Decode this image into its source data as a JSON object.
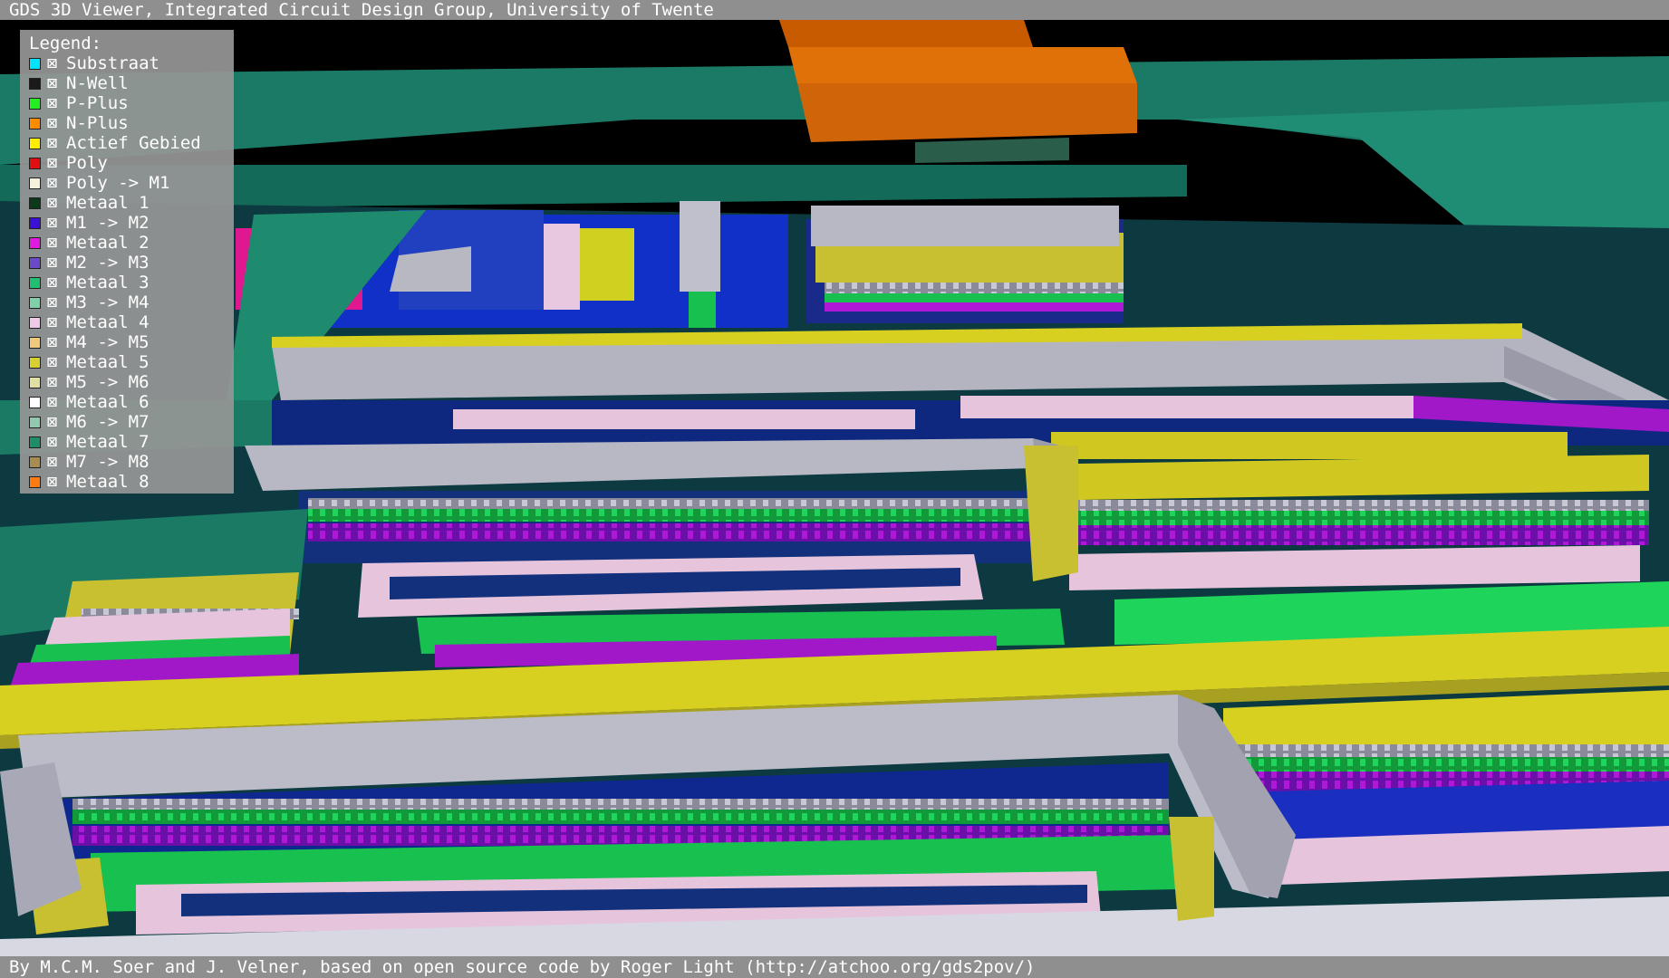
{
  "window": {
    "title": "GDS 3D Viewer, Integrated Circuit Design Group, University of Twente"
  },
  "legend": {
    "title": "Legend:",
    "items": [
      {
        "label": "Substraat",
        "color": "#00e5ff",
        "checked": "⊠"
      },
      {
        "label": "N-Well",
        "color": "#1a1a1a",
        "checked": "⊠"
      },
      {
        "label": "P-Plus",
        "color": "#22ee22",
        "checked": "⊠"
      },
      {
        "label": "N-Plus",
        "color": "#ff8c00",
        "checked": "⊠"
      },
      {
        "label": "Actief Gebied",
        "color": "#ffee00",
        "checked": "⊠"
      },
      {
        "label": "Poly",
        "color": "#e01010",
        "checked": "⊠"
      },
      {
        "label": "Poly -> M1",
        "color": "#f5f0dc",
        "checked": "⊠"
      },
      {
        "label": "Metaal 1",
        "color": "#0a3a1a",
        "checked": "⊠"
      },
      {
        "label": "M1 -> M2",
        "color": "#3a10d8",
        "checked": "⊠"
      },
      {
        "label": "Metaal 2",
        "color": "#e018e0",
        "checked": "⊠"
      },
      {
        "label": "M2 -> M3",
        "color": "#6a4ac8",
        "checked": "⊠"
      },
      {
        "label": "Metaal 3",
        "color": "#20c070",
        "checked": "⊠"
      },
      {
        "label": "M3 -> M4",
        "color": "#7fcfa8",
        "checked": "⊠"
      },
      {
        "label": "Metaal 4",
        "color": "#f0c8e8",
        "checked": "⊠"
      },
      {
        "label": "M4 -> M5",
        "color": "#f0c87a",
        "checked": "⊠"
      },
      {
        "label": "Metaal 5",
        "color": "#d8d030",
        "checked": "⊠"
      },
      {
        "label": "M5 -> M6",
        "color": "#e0e0a0",
        "checked": "⊠"
      },
      {
        "label": "Metaal 6",
        "color": "#ffffff",
        "checked": "⊠"
      },
      {
        "label": "M6 -> M7",
        "color": "#90c8b0",
        "checked": "⊠"
      },
      {
        "label": "Metaal 7",
        "color": "#1e8e6a",
        "checked": "⊠"
      },
      {
        "label": "M7 -> M8",
        "color": "#a88c50",
        "checked": "⊠"
      },
      {
        "label": "Metaal 8",
        "color": "#ff7a10",
        "checked": "⊠"
      }
    ]
  },
  "footer": {
    "credits": "By M.C.M. Soer and J. Velner, based on open source code by Roger Light (http://atchoo.org/gds2pov/)"
  }
}
